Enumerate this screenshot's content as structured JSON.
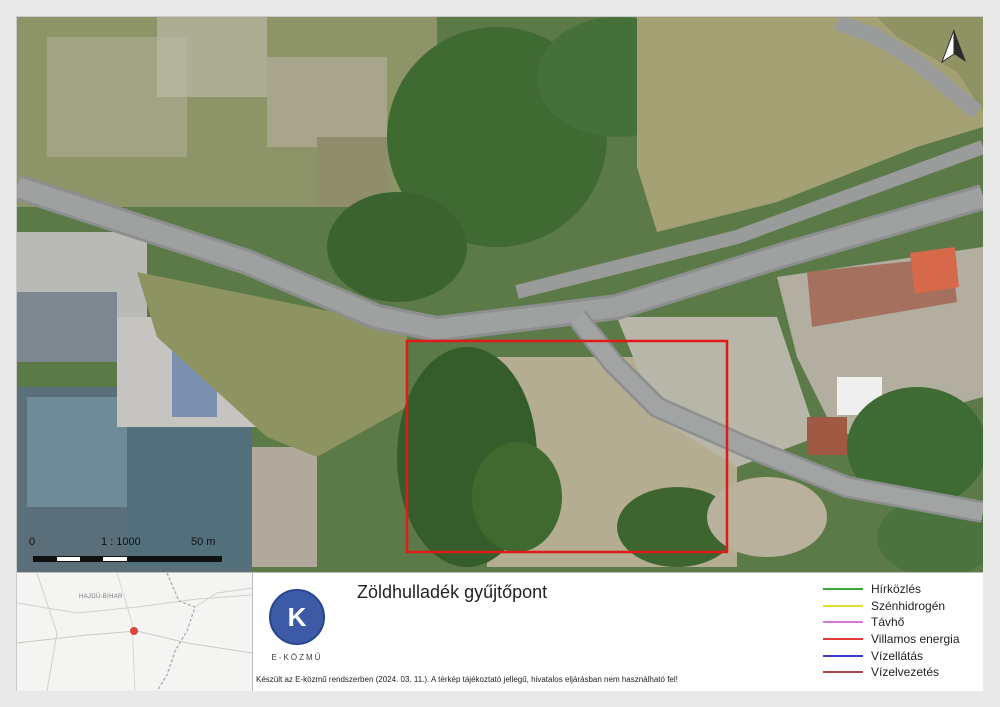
{
  "map": {
    "scale_ratio": "1 : 1000",
    "scale_start": "0",
    "scale_end": "50 m",
    "north_icon": "north-arrow-icon",
    "highlight_color": "#e11919"
  },
  "overview": {
    "place_label": "HAJDÚ-BIHAR",
    "marker_color": "#d9443b"
  },
  "logo": {
    "letter": "K",
    "text": "E-KÖZMŰ",
    "color": "#3c5aa6"
  },
  "title": "Zöldhulladék gyűjtőpont",
  "disclaimer": "Készült az E-közmű rendszerben (2024. 03. 11.). A térkép tájékoztató jellegű, hivatalos eljárásban nem használható fel!",
  "legend": [
    {
      "label": "Hírközlés",
      "color": "#3aa63a"
    },
    {
      "label": "Szénhidrogén",
      "color": "#e6dc2a"
    },
    {
      "label": "Távhő",
      "color": "#d77ad7"
    },
    {
      "label": "Villamos energia",
      "color": "#e23c3c"
    },
    {
      "label": "Vízellátás",
      "color": "#3b3bd0"
    },
    {
      "label": "Vízelvezetés",
      "color": "#b04545"
    }
  ]
}
